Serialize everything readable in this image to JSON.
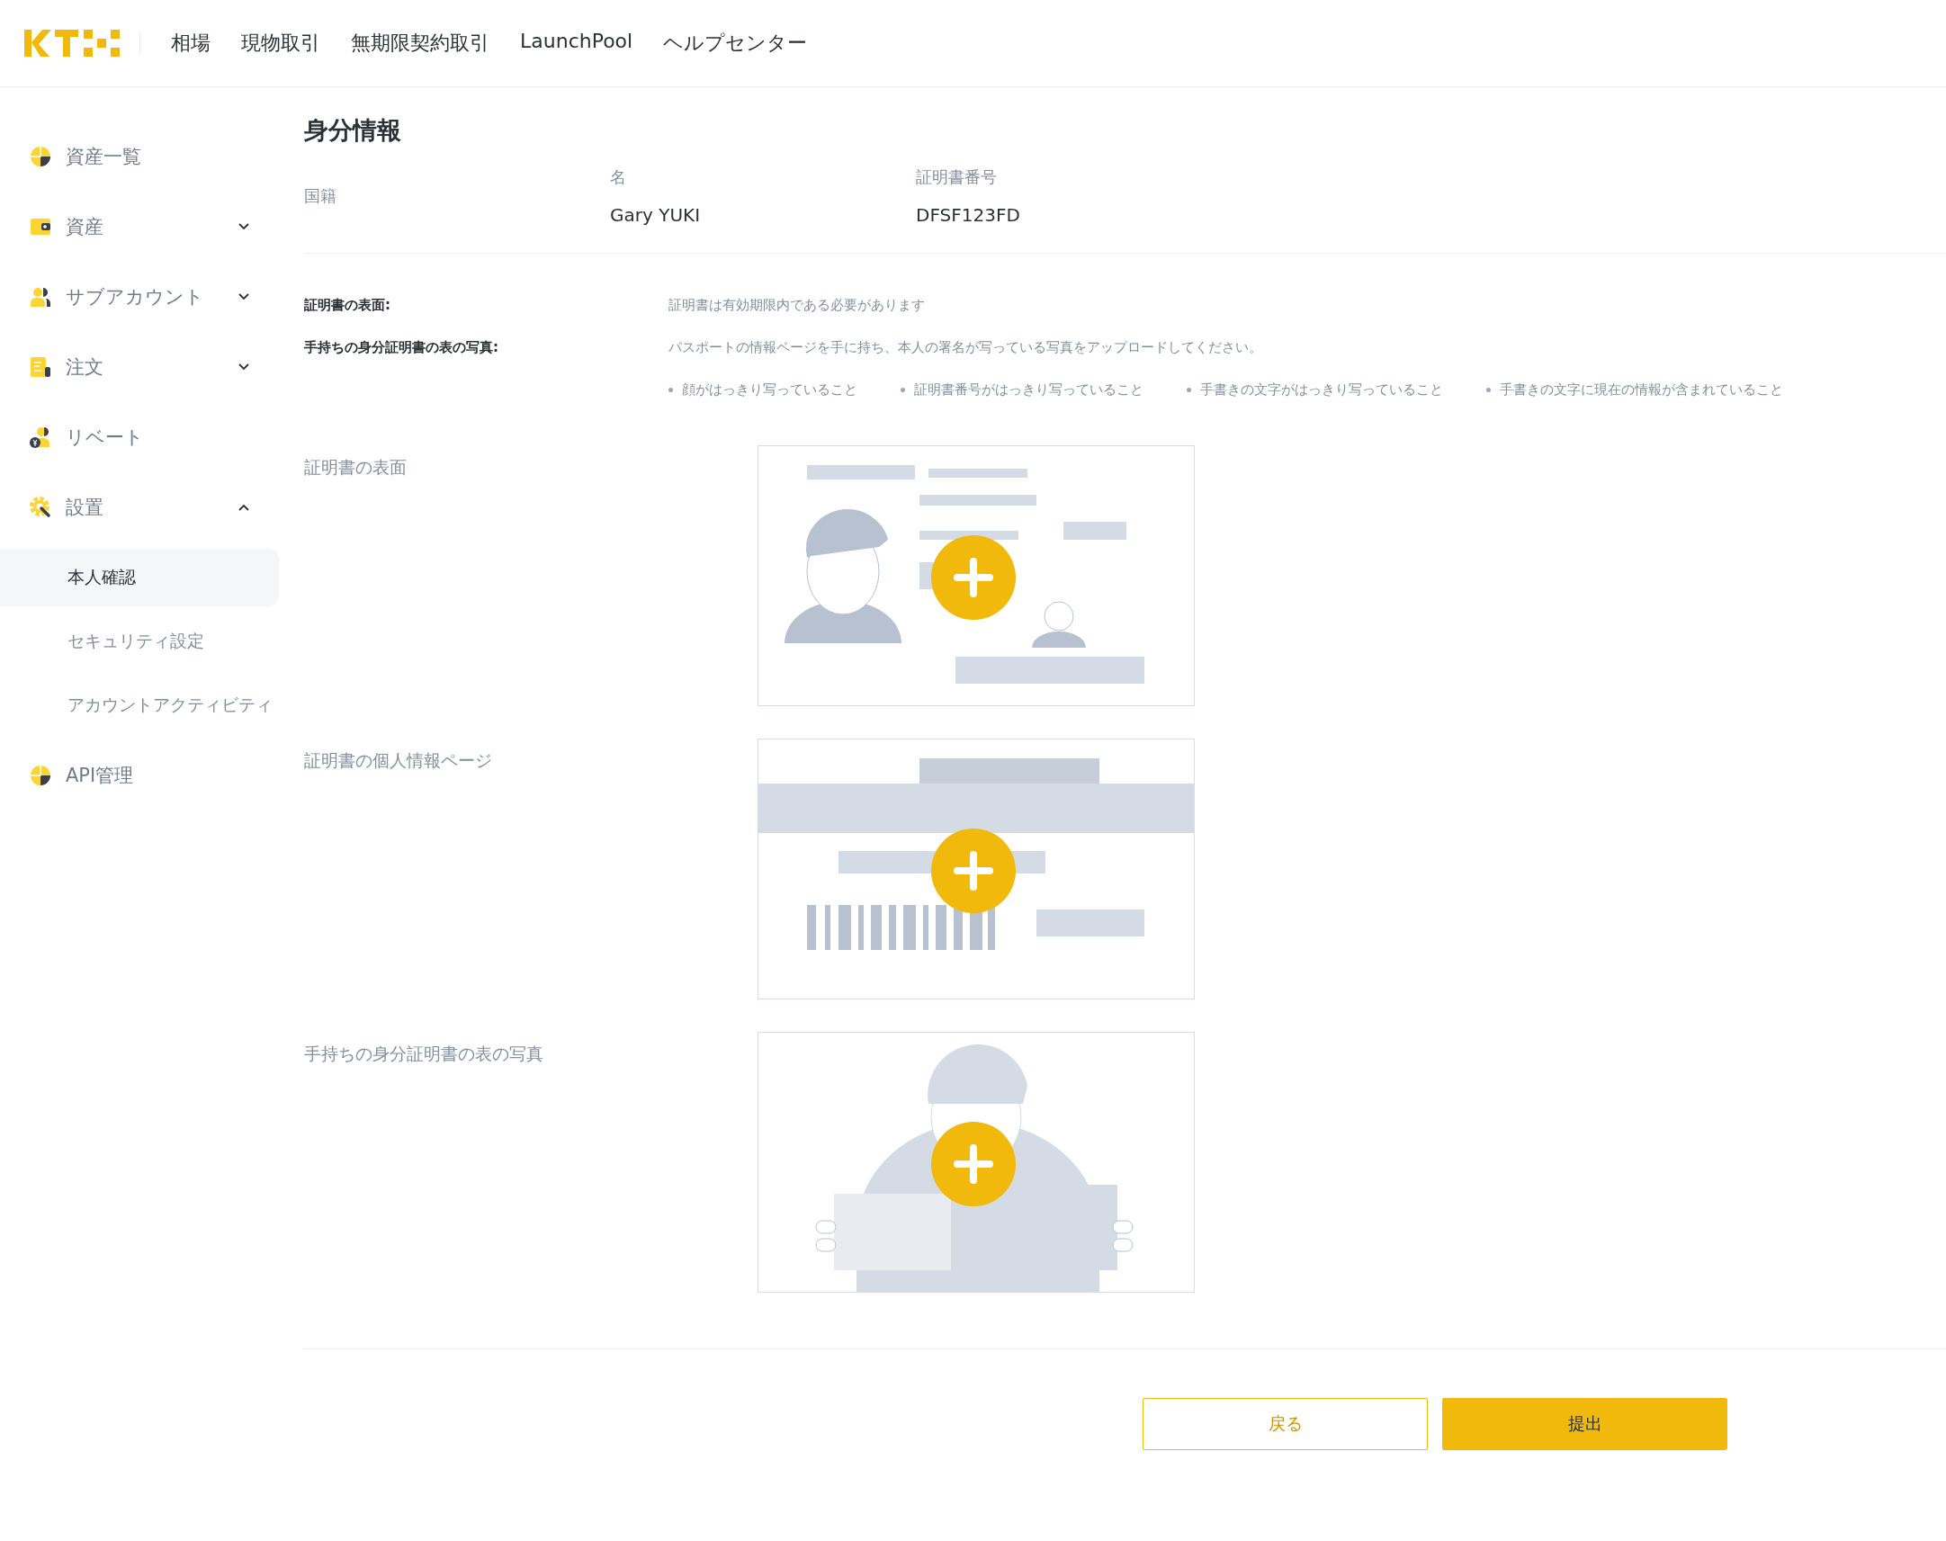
{
  "header": {
    "nav": [
      {
        "label": "相場"
      },
      {
        "label": "現物取引"
      },
      {
        "label": "無期限契約取引"
      },
      {
        "label": "LaunchPool"
      },
      {
        "label": "ヘルプセンター"
      }
    ]
  },
  "sidebar": {
    "items": [
      {
        "label": "資産一覧",
        "kind": "pie"
      },
      {
        "label": "資産",
        "kind": "wallet",
        "expanded": false
      },
      {
        "label": "サブアカウント",
        "kind": "users",
        "expanded": false
      },
      {
        "label": "注文",
        "kind": "doc",
        "expanded": false
      },
      {
        "label": "リベート",
        "kind": "rebate"
      },
      {
        "label": "設置",
        "kind": "gear",
        "expanded": true,
        "children": [
          {
            "label": "本人確認",
            "selected": true
          },
          {
            "label": "セキュリティ設定",
            "selected": false
          },
          {
            "label": "アカウントアクティビティ",
            "selected": false
          }
        ]
      },
      {
        "label": "API管理",
        "kind": "pie"
      }
    ]
  },
  "page": {
    "title": "身分情報",
    "fields": [
      {
        "label": "国籍"
      },
      {
        "label": "名",
        "value": "Gary YUKI"
      },
      {
        "label": "証明書番号",
        "value": "DFSF123FD"
      }
    ],
    "requirements": [
      {
        "label": "証明書の表面:",
        "text": "証明書は有効期限内である必要があります"
      },
      {
        "label": "手持ちの身分証明書の表の写真:",
        "text": "パスポートの情報ページを手に持ち、本人の署名が写っている写真をアップロードしてください。"
      }
    ],
    "bullets": [
      "顔がはっきり写っていること",
      "証明書番号がはっきり写っていること",
      "手書きの文字がはっきり写っていること",
      "手書きの文字に現在の情報が含まれていること"
    ],
    "uploads": [
      {
        "label": "証明書の表面",
        "kind": "front"
      },
      {
        "label": "証明書の個人情報ページ",
        "kind": "back"
      },
      {
        "label": "手持ちの身分証明書の表の写真",
        "kind": "selfie"
      }
    ],
    "buttons": [
      {
        "label": "戻る",
        "kind": "secondary"
      },
      {
        "label": "提出",
        "kind": "primary"
      }
    ]
  }
}
